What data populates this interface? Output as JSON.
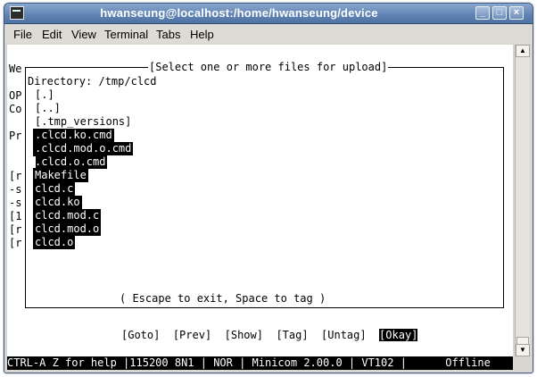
{
  "window": {
    "title": "hwanseung@localhost:/home/hwanseung/device"
  },
  "menu": [
    "File",
    "Edit",
    "View",
    "Terminal",
    "Tabs",
    "Help"
  ],
  "background_lines": [
    "We",
    "OP",
    "Co",
    "Pr",
    "[r",
    "-s",
    "-s",
    "[1",
    "[r",
    "[r"
  ],
  "dialog": {
    "title": "[Select one or more files for upload]",
    "directory": "Directory: /tmp/clcd",
    "files": [
      {
        "name": "[.]",
        "tagged": false
      },
      {
        "name": "[..]",
        "tagged": false
      },
      {
        "name": "[.tmp_versions]",
        "tagged": false
      },
      {
        "name": ".clcd.ko.cmd",
        "tagged": true
      },
      {
        "name": ".clcd.mod.o.cmd",
        "tagged": true
      },
      {
        "name": ".clcd.o.cmd",
        "tagged": true
      },
      {
        "name": "Makefile",
        "tagged": true
      },
      {
        "name": "clcd.c",
        "tagged": true
      },
      {
        "name": "clcd.ko",
        "tagged": true
      },
      {
        "name": "clcd.mod.c",
        "tagged": true
      },
      {
        "name": "clcd.mod.o",
        "tagged": true
      },
      {
        "name": "clcd.o",
        "tagged": true
      }
    ],
    "hint": "( Escape to exit, Space to tag )"
  },
  "buttons": {
    "goto": "[Goto]",
    "prev": "[Prev]",
    "show": "[Show]",
    "tag": "[Tag]",
    "untag": "[Untag]",
    "okay": "[Okay]"
  },
  "status": "CTRL-A Z for help |115200 8N1 | NOR | Minicom 2.00.0 | VT102 |      Offline"
}
